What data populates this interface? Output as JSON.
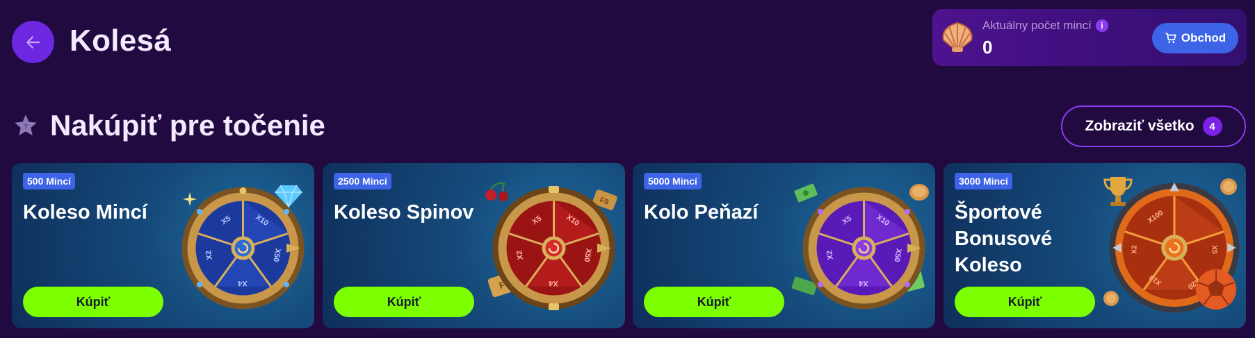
{
  "header": {
    "title": "Kolesá",
    "back_icon": "arrow-left-icon"
  },
  "coins": {
    "label": "Aktuálny počet mincí",
    "value": "0",
    "info_symbol": "i",
    "shop_label": "Obchod",
    "icon": "shell-coin-icon"
  },
  "section": {
    "title": "Nakúpiť pre točenie",
    "view_all_label": "Zobraziť všetko",
    "view_all_count": "4",
    "icon": "star-icon"
  },
  "cards": [
    {
      "price": "500 Mincí",
      "title": "Koleso Mincí",
      "button": "Kúpiť",
      "wheel_labels": [
        "X5",
        "X10",
        "X50",
        "X4",
        "X2"
      ]
    },
    {
      "price": "2500 Mincí",
      "title": "Koleso Spinov",
      "button": "Kúpiť",
      "wheel_labels": [
        "X5",
        "X10",
        "X50",
        "X4",
        "X2"
      ]
    },
    {
      "price": "5000 Mincí",
      "title": "Kolo Peňazí",
      "button": "Kúpiť",
      "wheel_labels": [
        "X5",
        "X10",
        "X50",
        "X4",
        "X2"
      ]
    },
    {
      "price": "3000 Mincí",
      "title": "Športové Bonusové Koleso",
      "button": "Kúpiť",
      "wheel_labels": [
        "X100",
        "X5",
        "X20",
        "X10",
        "X2"
      ]
    }
  ],
  "colors": {
    "background": "#200a40",
    "accent_purple": "#6d27e0",
    "buy_green": "#7cff00",
    "badge_blue": "#3d63e6",
    "wheel_blue": "#1c3a9e",
    "wheel_red": "#9a1414",
    "wheel_purple": "#5a1ab8",
    "wheel_orange": "#a8300e"
  }
}
